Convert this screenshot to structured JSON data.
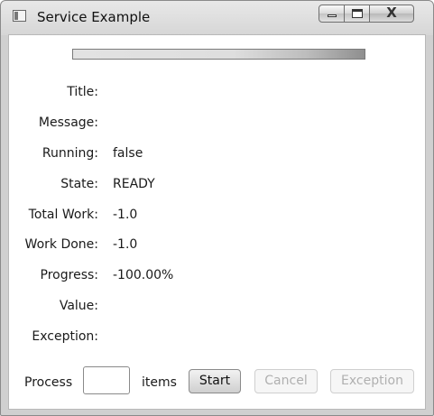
{
  "window": {
    "title": "Service Example",
    "icons": {
      "app": "window-app-icon",
      "minimize": "minimize-icon",
      "maximize": "maximize-icon",
      "close": "close-icon"
    },
    "close_glyph": "X"
  },
  "progress": {
    "value": -1.0,
    "indeterminate": true
  },
  "fields": [
    {
      "label": "Title:",
      "value": ""
    },
    {
      "label": "Message:",
      "value": ""
    },
    {
      "label": "Running:",
      "value": "false"
    },
    {
      "label": "State:",
      "value": "READY"
    },
    {
      "label": "Total Work:",
      "value": "-1.0"
    },
    {
      "label": "Work Done:",
      "value": "-1.0"
    },
    {
      "label": "Progress:",
      "value": "-100.00%"
    },
    {
      "label": "Value:",
      "value": ""
    },
    {
      "label": "Exception:",
      "value": ""
    }
  ],
  "controls": {
    "process_label": "Process",
    "items_value": "",
    "items_label": "items",
    "start_label": "Start",
    "cancel_label": "Cancel",
    "exception_label": "Exception"
  }
}
